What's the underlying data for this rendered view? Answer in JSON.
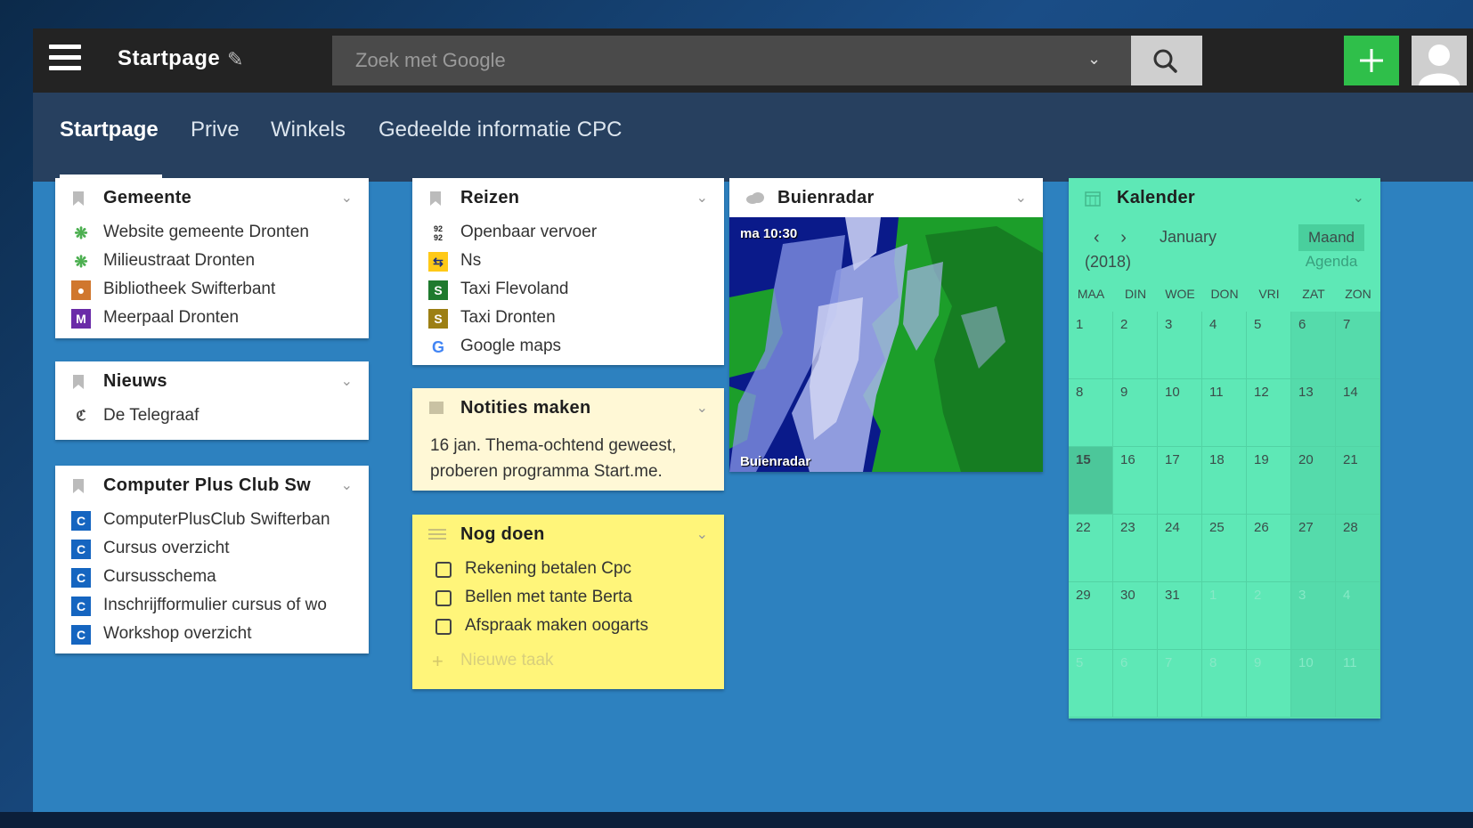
{
  "header": {
    "title": "Startpage",
    "search_placeholder": "Zoek met Google"
  },
  "tabs": [
    {
      "label": "Startpage",
      "active": true
    },
    {
      "label": "Prive"
    },
    {
      "label": "Winkels"
    },
    {
      "label": "Gedeelde informatie CPC"
    }
  ],
  "widgets": {
    "gemeente": {
      "title": "Gemeente",
      "items": [
        {
          "label": "Website gemeente Dronten",
          "icon": "gemeente-icon"
        },
        {
          "label": "Milieustraat Dronten",
          "icon": "gemeente-icon"
        },
        {
          "label": "Bibliotheek Swifterbant",
          "icon": "bibliotheek-icon"
        },
        {
          "label": "Meerpaal Dronten",
          "icon": "m-icon"
        }
      ]
    },
    "nieuws": {
      "title": "Nieuws",
      "items": [
        {
          "label": "De Telegraaf",
          "icon": "telegraaf-icon"
        }
      ]
    },
    "computerclub": {
      "title": "Computer Plus Club Sw",
      "items": [
        {
          "label": "ComputerPlusClub Swifterban",
          "icon": "c-icon"
        },
        {
          "label": "Cursus overzicht",
          "icon": "c-icon"
        },
        {
          "label": "Cursusschema",
          "icon": "c-icon"
        },
        {
          "label": "Inschrijfformulier cursus of wo",
          "icon": "c-icon"
        },
        {
          "label": "Workshop overzicht",
          "icon": "c-icon"
        }
      ]
    },
    "reizen": {
      "title": "Reizen",
      "items": [
        {
          "label": "Openbaar vervoer",
          "icon": "9292-icon"
        },
        {
          "label": "Ns",
          "icon": "ns-icon"
        },
        {
          "label": "Taxi Flevoland",
          "icon": "s-green-icon"
        },
        {
          "label": "Taxi Dronten",
          "icon": "s-olive-icon"
        },
        {
          "label": "Google maps",
          "icon": "google-icon"
        }
      ]
    },
    "notities": {
      "title": "Notities maken",
      "text": "16 jan. Thema-ochtend geweest, proberen programma Start.me."
    },
    "nogdoen": {
      "title": "Nog doen",
      "tasks": [
        {
          "label": "Rekening betalen Cpc",
          "done": false
        },
        {
          "label": "Bellen met tante Berta",
          "done": false
        },
        {
          "label": "Afspraak maken oogarts",
          "done": false
        }
      ],
      "new_task": "Nieuwe taak"
    },
    "buienradar": {
      "title": "Buienradar",
      "time": "ma 10:30",
      "brand": "Buienradar"
    },
    "kalender": {
      "title": "Kalender",
      "month": "January",
      "year": "(2018)",
      "mode_active": "Maand",
      "mode_other": "Agenda",
      "weekdays": [
        "MAA",
        "DIN",
        "WOE",
        "DON",
        "VRI",
        "ZAT",
        "ZON"
      ],
      "weeks": [
        [
          "1",
          "2",
          "3",
          "4",
          "5",
          "6",
          "7"
        ],
        [
          "8",
          "9",
          "10",
          "11",
          "12",
          "13",
          "14"
        ],
        [
          "15",
          "16",
          "17",
          "18",
          "19",
          "20",
          "21"
        ],
        [
          "22",
          "23",
          "24",
          "25",
          "26",
          "27",
          "28"
        ],
        [
          "29",
          "30",
          "31",
          "1",
          "2",
          "3",
          "4"
        ],
        [
          "5",
          "6",
          "7",
          "8",
          "9",
          "10",
          "11"
        ]
      ],
      "today": "15"
    }
  },
  "colors": {
    "app_background": "#2d81bf",
    "topbar": "#232323",
    "tabbar": "#27405f",
    "add_button": "#2fbf4a",
    "note_background": "#fff8d6",
    "todo_background": "#fff57a",
    "calendar_background": "#5ee8b6"
  }
}
